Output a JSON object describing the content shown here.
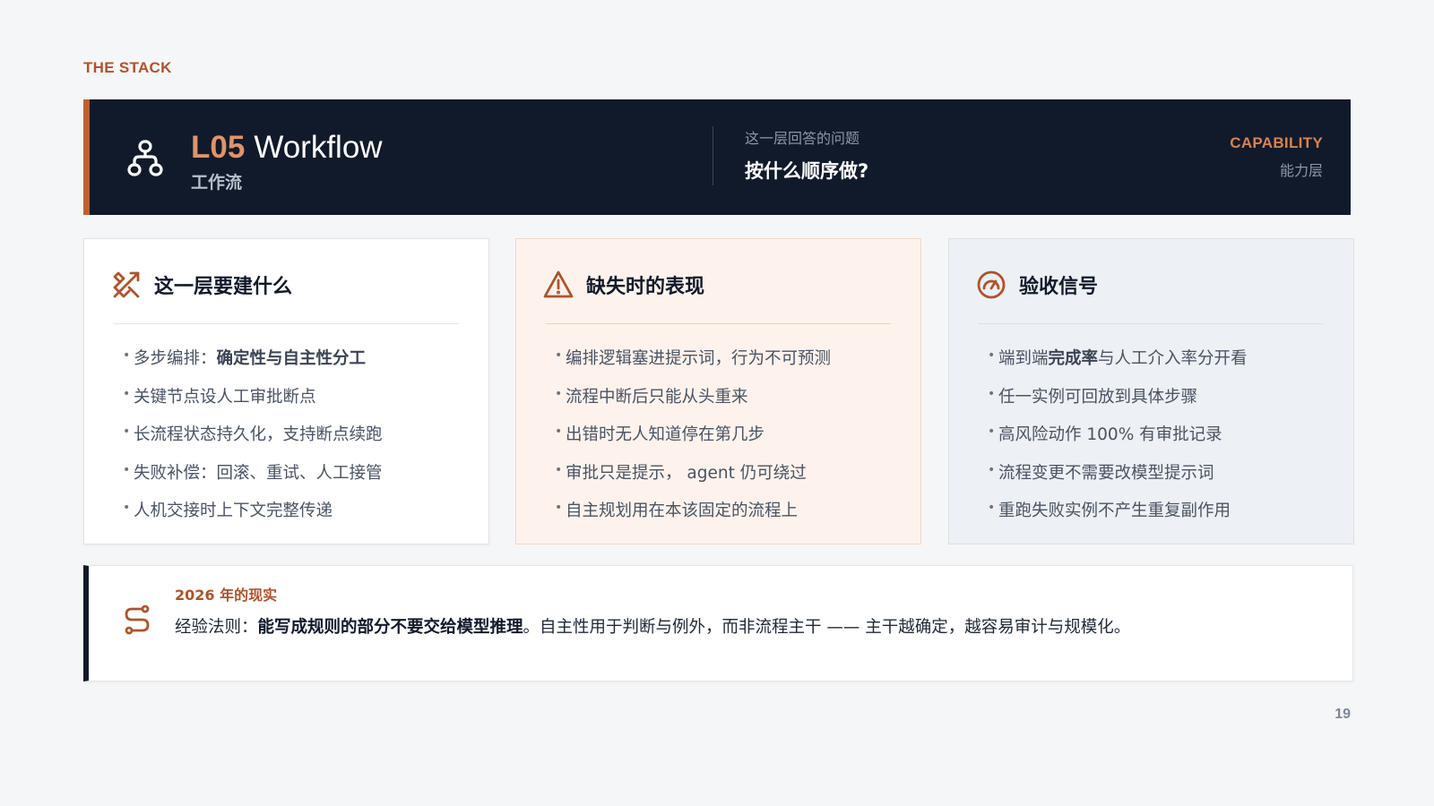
{
  "eyebrow": "THE STACK",
  "header": {
    "code": "L05",
    "title": "Workflow",
    "subtitle": "工作流",
    "question_label": "这一层回答的问题",
    "question": "按什么顺序做?",
    "category": "CAPABILITY",
    "category_sub": "能力层",
    "icon": "workflow-nodes-icon"
  },
  "cards": [
    {
      "title": "这一层要建什么",
      "icon": "tools-icon",
      "items": [
        {
          "prefix": "多步编排：",
          "bold": "确定性与自主性分工",
          "suffix": ""
        },
        {
          "prefix": "关键节点设人工审批断点",
          "bold": "",
          "suffix": ""
        },
        {
          "prefix": "长流程状态持久化，支持断点续跑",
          "bold": "",
          "suffix": ""
        },
        {
          "prefix": "失败补偿：回滚、重试、人工接管",
          "bold": "",
          "suffix": ""
        },
        {
          "prefix": "人机交接时上下文完整传递",
          "bold": "",
          "suffix": ""
        }
      ]
    },
    {
      "title": "缺失时的表现",
      "icon": "warning-icon",
      "items": [
        {
          "prefix": "编排逻辑塞进提示词，行为不可预测",
          "bold": "",
          "suffix": ""
        },
        {
          "prefix": "流程中断后只能从头重来",
          "bold": "",
          "suffix": ""
        },
        {
          "prefix": "出错时无人知道停在第几步",
          "bold": "",
          "suffix": ""
        },
        {
          "prefix": "审批只是提示， agent 仍可绕过",
          "bold": "",
          "suffix": ""
        },
        {
          "prefix": "自主规划用在本该固定的流程上",
          "bold": "",
          "suffix": ""
        }
      ]
    },
    {
      "title": "验收信号",
      "icon": "gauge-icon",
      "items": [
        {
          "prefix": "端到端",
          "bold": "完成率",
          "suffix": "与人工介入率分开看"
        },
        {
          "prefix": "任一实例可回放到具体步骤",
          "bold": "",
          "suffix": ""
        },
        {
          "prefix": "高风险动作 100% 有审批记录",
          "bold": "",
          "suffix": ""
        },
        {
          "prefix": "流程变更不需要改模型提示词",
          "bold": "",
          "suffix": ""
        },
        {
          "prefix": "重跑失败实例不产生重复副作用",
          "bold": "",
          "suffix": ""
        }
      ]
    }
  ],
  "callout": {
    "kicker": "2026 年的现实",
    "prefix": "经验法则：",
    "bold": "能写成规则的部分不要交给模型推理",
    "suffix": "。自主性用于判断与例外，而非流程主干 —— 主干越确定，越容易审计与规模化。",
    "icon": "route-icon"
  },
  "page_number": "19",
  "colors": {
    "accent": "#b0532b",
    "navy": "#111a2b",
    "warm_bg": "#fdf3ec",
    "cool_bg": "#edf0f4"
  }
}
